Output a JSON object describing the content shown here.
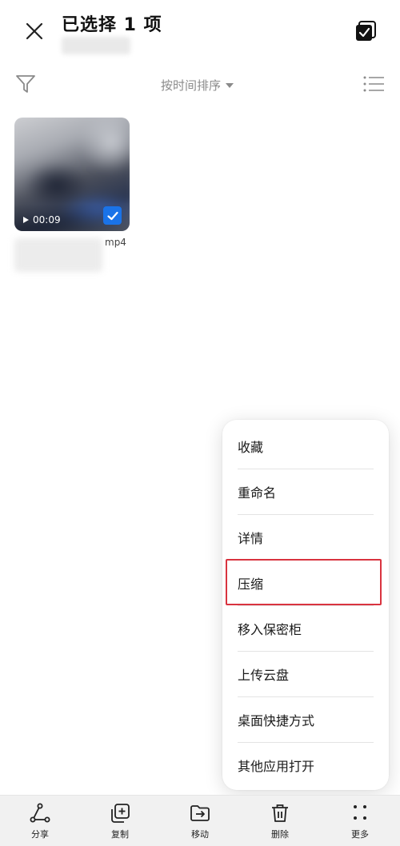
{
  "header": {
    "title": "已选择 1 项"
  },
  "sort": {
    "label": "按时间排序"
  },
  "file": {
    "duration": "00:09",
    "extension": "mp4",
    "selected": true
  },
  "context_menu": {
    "items": [
      {
        "label": "收藏"
      },
      {
        "label": "重命名"
      },
      {
        "label": "详情"
      },
      {
        "label": "压缩"
      },
      {
        "label": "移入保密柜"
      },
      {
        "label": "上传云盘"
      },
      {
        "label": "桌面快捷方式"
      },
      {
        "label": "其他应用打开"
      }
    ],
    "highlighted": "压缩"
  },
  "bottom_bar": {
    "items": [
      {
        "label": "分享",
        "icon": "share-icon"
      },
      {
        "label": "复制",
        "icon": "copy-icon"
      },
      {
        "label": "移动",
        "icon": "move-icon"
      },
      {
        "label": "删除",
        "icon": "delete-icon"
      },
      {
        "label": "更多",
        "icon": "more-icon"
      }
    ]
  },
  "colors": {
    "accent": "#1a73e8",
    "highlight_border": "#d9333f"
  }
}
